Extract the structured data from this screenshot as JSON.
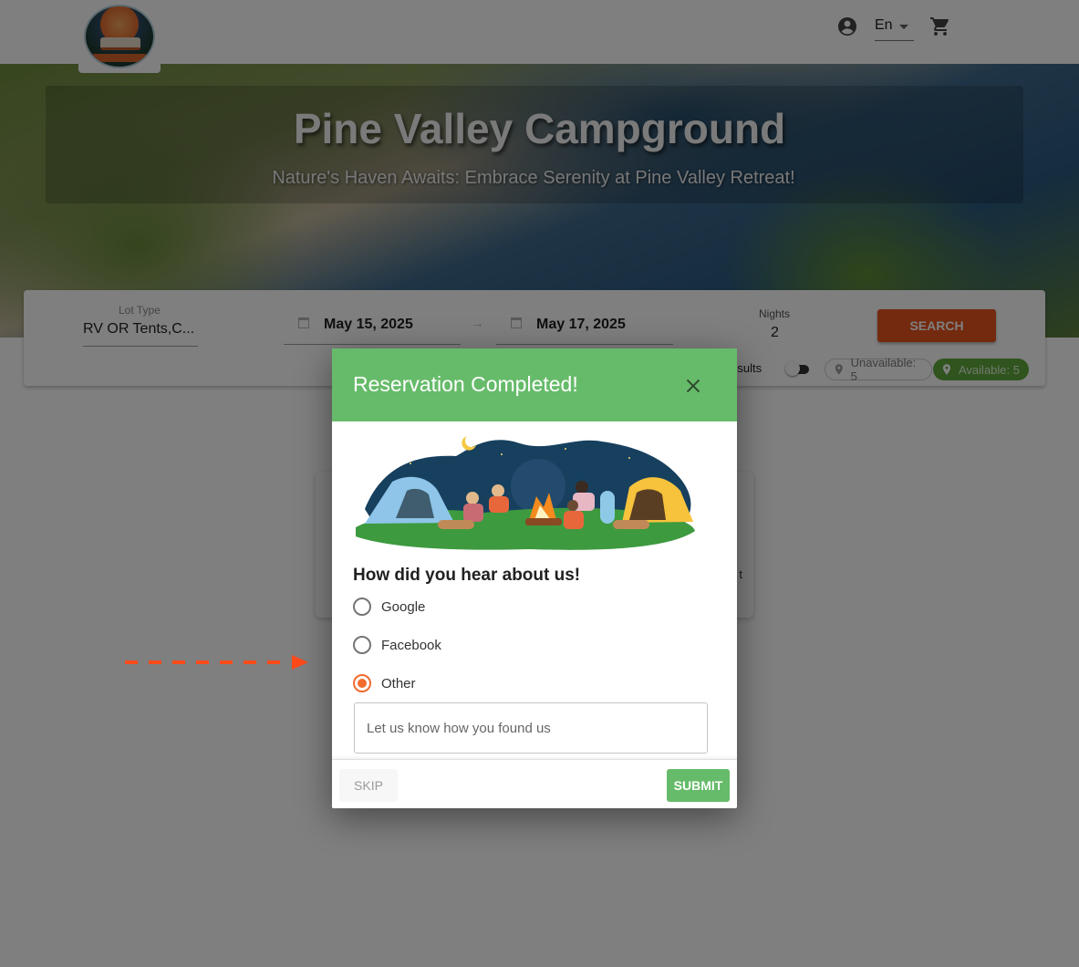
{
  "header": {
    "logo_alt": "Campground logo",
    "language": "En",
    "icons": {
      "account": "account-circle-icon",
      "cart": "shopping-cart-icon",
      "language_caret": "caret-down-icon"
    }
  },
  "hero": {
    "title": "Pine Valley Campground",
    "subtitle": "Nature's Haven Awaits: Embrace Serenity at Pine Valley Retreat!"
  },
  "search": {
    "lot_type_label": "Lot Type",
    "lot_type_value": "RV OR Tents,C...",
    "check_in": "May 15, 2025",
    "check_out": "May 17, 2025",
    "date_separator": "→",
    "nights_label": "Nights",
    "nights_value": "2",
    "search_button": "SEARCH",
    "results_toggle_label": "e results",
    "unavailable_chip": "Unavailable: 5",
    "available_chip": "Available: 5"
  },
  "background_card": {
    "partial_text": "t"
  },
  "modal": {
    "title": "Reservation Completed!",
    "question": "How did you hear about us!",
    "options": [
      {
        "label": "Google",
        "checked": false
      },
      {
        "label": "Facebook",
        "checked": false
      },
      {
        "label": "Other",
        "checked": true
      }
    ],
    "input_value": "",
    "input_placeholder": "Let us know how you found us",
    "skip_button": "SKIP",
    "submit_button": "SUBMIT"
  },
  "colors": {
    "modal_header": "#66bb6a",
    "accent_orange": "#e8541d",
    "radio_selected": "#f26b2f",
    "available_chip": "#5ea83a",
    "annotation_arrow": "#ff4a1a"
  }
}
